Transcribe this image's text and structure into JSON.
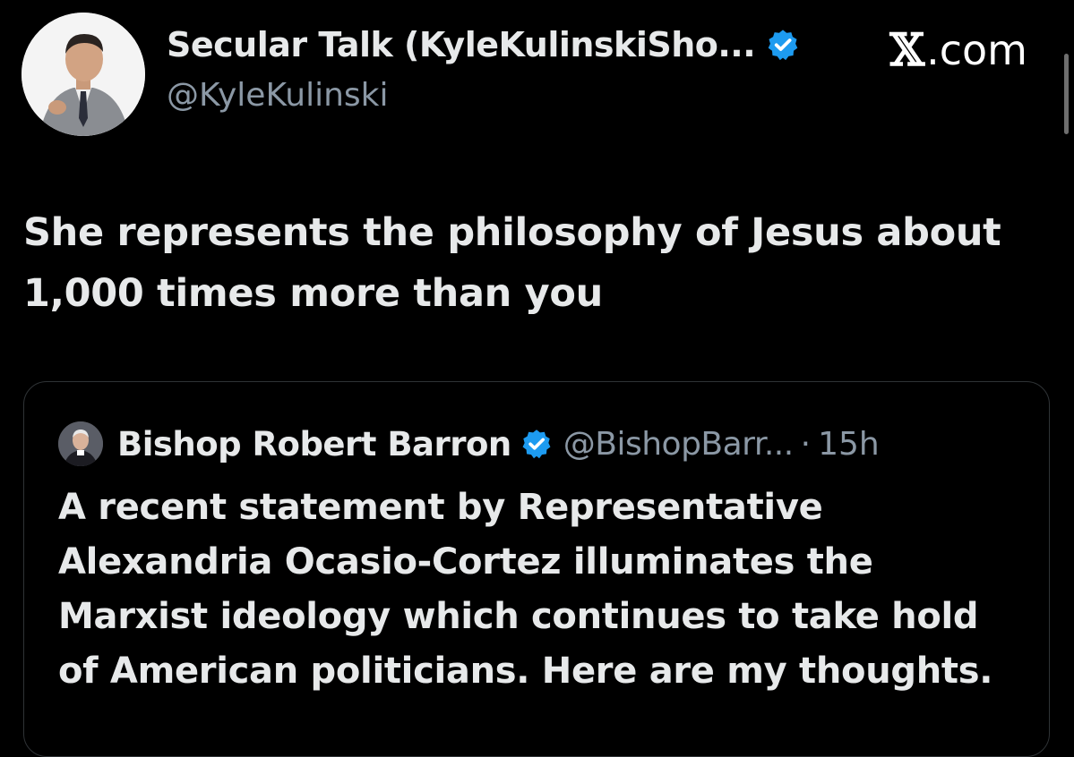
{
  "author": {
    "display_name": "Secular Talk (KyleKulinskiSho...",
    "handle": "@KyleKulinski",
    "avatar_icon": "profile-photo",
    "verified_icon": "verified-badge-icon"
  },
  "brand": {
    "x_glyph": "𝕏",
    "domain": ".com"
  },
  "tweet": {
    "text": "She represents the philosophy of Jesus about 1,000 times more than you"
  },
  "quoted_tweet": {
    "display_name": "Bishop Robert Barron",
    "handle": "@BishopBarr...",
    "separator": "·",
    "time": "15h",
    "text": "A recent statement by Representative Alexandria Ocasio-Cortez illuminates the Marxist ideology which continues to take hold of American politicians. Here are my thoughts.",
    "avatar_icon": "profile-photo",
    "verified_icon": "verified-badge-icon"
  },
  "colors": {
    "background": "#000000",
    "primary_text": "#e7e9ea",
    "secondary_text": "#8b98a5",
    "verified_blue": "#1d9bf0",
    "card_border": "#2f3336"
  }
}
